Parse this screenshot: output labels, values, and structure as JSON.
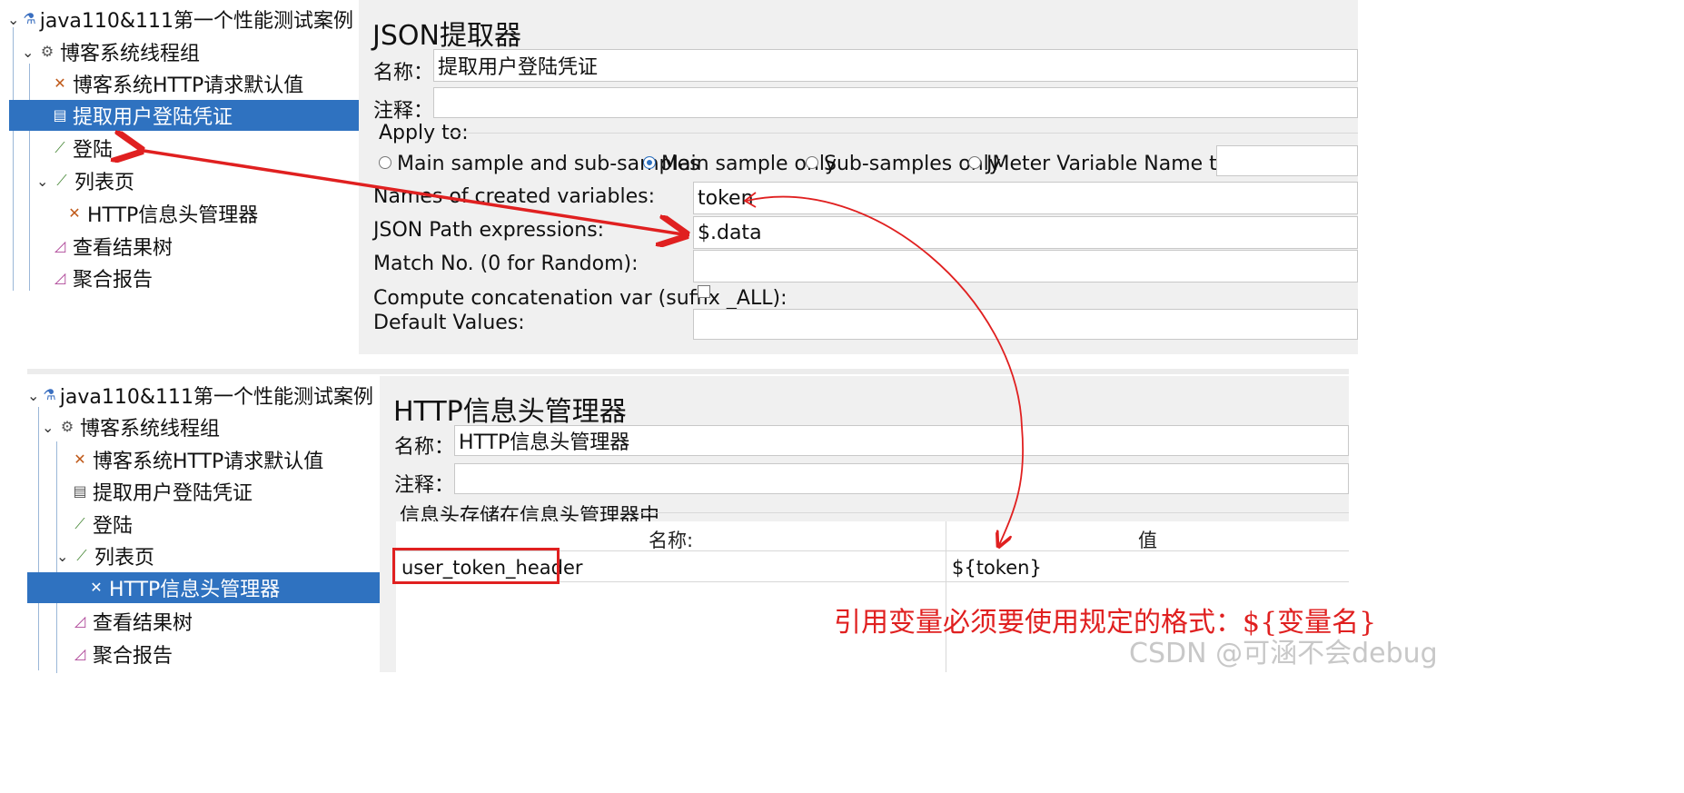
{
  "top_tree": {
    "items": [
      {
        "label": "java110&111第一个性能测试案例",
        "icon": "flask-icon"
      },
      {
        "label": "博客系统线程组",
        "icon": "gear-icon"
      },
      {
        "label": "博客系统HTTP请求默认值",
        "icon": "tools-icon"
      },
      {
        "label": "提取用户登陆凭证",
        "icon": "extractor-icon"
      },
      {
        "label": "登陆",
        "icon": "pipette-icon"
      },
      {
        "label": "列表页",
        "icon": "pipette-icon"
      },
      {
        "label": "HTTP信息头管理器",
        "icon": "tools-icon"
      },
      {
        "label": "查看结果树",
        "icon": "chart-icon"
      },
      {
        "label": "聚合报告",
        "icon": "chart-icon"
      }
    ]
  },
  "json_extractor": {
    "title": "JSON提取器",
    "name_label": "名称：",
    "name_value": "提取用户登陆凭证",
    "comment_label": "注释：",
    "comment_value": "",
    "apply_to_label": "Apply to:",
    "apply_options": [
      "Main sample and sub-samples",
      "Main sample only",
      "Sub-samples only",
      "JMeter Variable Name to use"
    ],
    "apply_selected": "Main sample only",
    "var_names_label": "Names of created variables:",
    "var_names_value": "token",
    "json_path_label": "JSON Path expressions:",
    "json_path_value": "$.data",
    "match_no_label": "Match No. (0 for Random):",
    "match_no_value": "",
    "concat_label": "Compute concatenation var (suffix _ALL):",
    "default_label": "Default Values:",
    "default_value": ""
  },
  "bottom_tree": {
    "items": [
      {
        "label": "java110&111第一个性能测试案例",
        "icon": "flask-icon"
      },
      {
        "label": "博客系统线程组",
        "icon": "gear-icon"
      },
      {
        "label": "博客系统HTTP请求默认值",
        "icon": "tools-icon"
      },
      {
        "label": "提取用户登陆凭证",
        "icon": "extractor-icon"
      },
      {
        "label": "登陆",
        "icon": "pipette-icon"
      },
      {
        "label": "列表页",
        "icon": "pipette-icon"
      },
      {
        "label": "HTTP信息头管理器",
        "icon": "tools-icon"
      },
      {
        "label": "查看结果树",
        "icon": "chart-icon"
      },
      {
        "label": "聚合报告",
        "icon": "chart-icon"
      }
    ]
  },
  "header_manager": {
    "title": "HTTP信息头管理器",
    "name_label": "名称：",
    "name_value": "HTTP信息头管理器",
    "comment_label": "注释：",
    "comment_value": "",
    "section_label": "信息头存储在信息头管理器中",
    "col_name": "名称:",
    "col_value": "值",
    "rows": [
      {
        "name": "user_token_header",
        "value": "${token}"
      }
    ]
  },
  "annotation": {
    "note": "引用变量必须要使用规定的格式：${变量名}",
    "arrow_color": "#e02020"
  },
  "watermark": "CSDN @可涵不会debug",
  "colors": {
    "selection": "#2f72c0",
    "panel_bg": "#f0f0f0",
    "annotation": "#e02020"
  }
}
